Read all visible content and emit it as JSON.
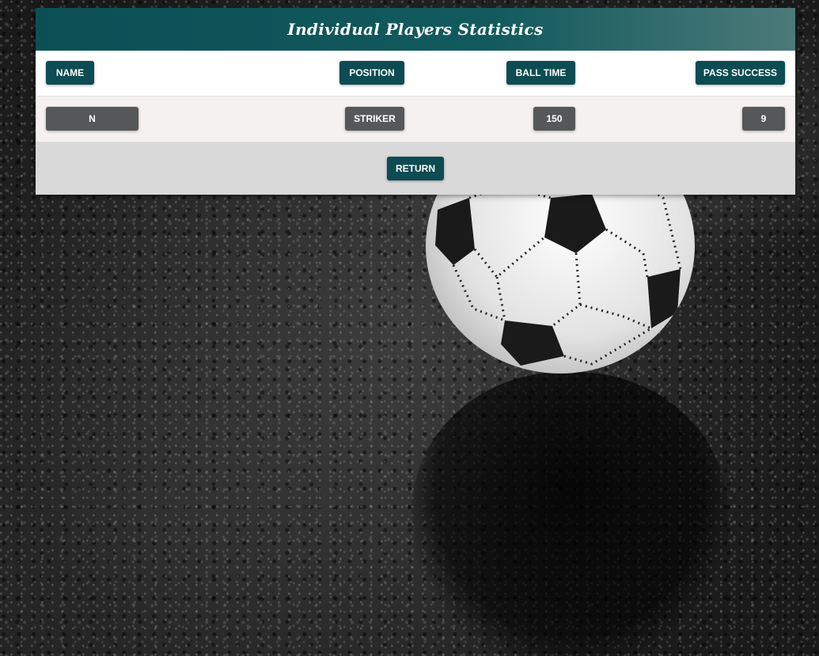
{
  "page": {
    "title": "Individual Players Statistics"
  },
  "table": {
    "headers": {
      "name": "NAME",
      "position": "POSITION",
      "ball_time": "BALL TIME",
      "pass_success": "PASS SUCCESS"
    },
    "rows": [
      {
        "name": "N",
        "position": "STRIKER",
        "ball_time": "150",
        "pass_success": "9"
      }
    ]
  },
  "footer": {
    "return_label": "RETURN"
  },
  "colors": {
    "header_gradient_start": "#0b4f55",
    "header_gradient_end": "#4c7a79",
    "teal_button": "#0c4c52",
    "grey_button": "#555759",
    "footer_background": "#d9d9d9"
  }
}
